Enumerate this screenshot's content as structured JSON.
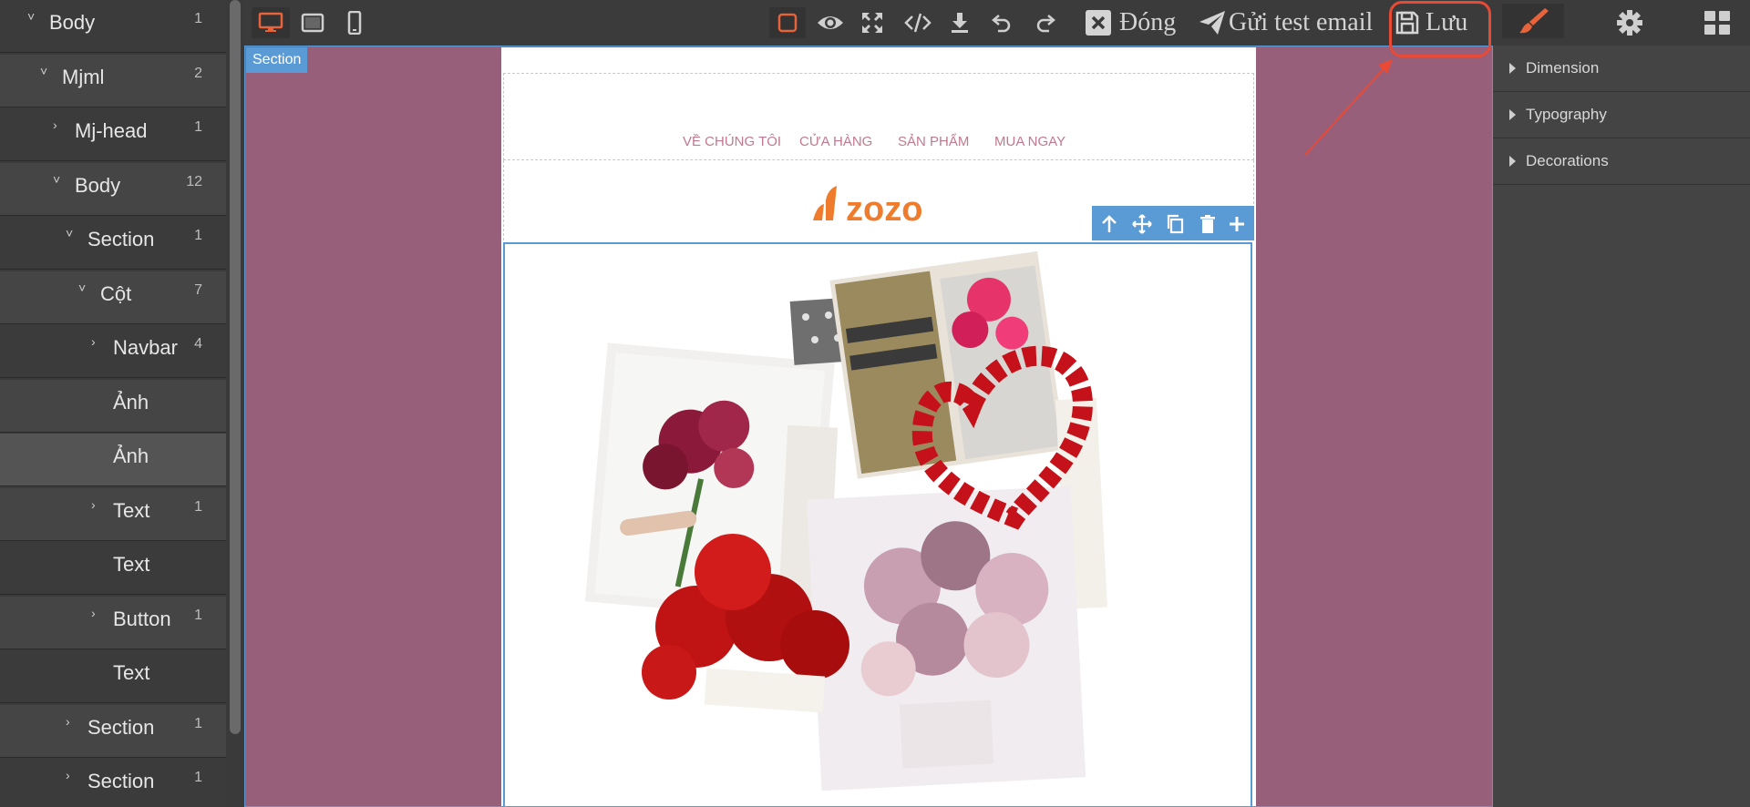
{
  "layers": [
    {
      "name": "Body",
      "count": "1",
      "indent": 0,
      "caret": true
    },
    {
      "name": "Mjml",
      "count": "2",
      "indent": 1,
      "caret": true
    },
    {
      "name": "Mj-head",
      "count": "1",
      "indent": 2,
      "caret": true,
      "collapsed": true
    },
    {
      "name": "Body",
      "count": "12",
      "indent": 2,
      "caret": true
    },
    {
      "name": "Section",
      "count": "1",
      "indent": 3,
      "caret": true
    },
    {
      "name": "Cột",
      "count": "7",
      "indent": 4,
      "caret": true
    },
    {
      "name": "Navbar",
      "count": "4",
      "indent": 5,
      "caret": true,
      "collapsed": true
    },
    {
      "name": "Ảnh",
      "count": "",
      "indent": 5,
      "caret": false
    },
    {
      "name": "Ảnh",
      "count": "",
      "indent": 5,
      "caret": false,
      "selected": true
    },
    {
      "name": "Text",
      "count": "1",
      "indent": 5,
      "caret": true,
      "collapsed": true
    },
    {
      "name": "Text",
      "count": "",
      "indent": 5,
      "caret": false
    },
    {
      "name": "Button",
      "count": "1",
      "indent": 5,
      "caret": true,
      "collapsed": true
    },
    {
      "name": "Text",
      "count": "",
      "indent": 5,
      "caret": false
    },
    {
      "name": "Section",
      "count": "1",
      "indent": 3,
      "caret": true,
      "collapsed": true
    },
    {
      "name": "Section",
      "count": "1",
      "indent": 3,
      "caret": true,
      "collapsed": true
    }
  ],
  "toolbar": {
    "close_label": "Đóng",
    "send_test_label": "Gửi test email",
    "save_label": "Lưu"
  },
  "canvas": {
    "section_badge": "Section",
    "nav_links": [
      "VỀ CHÚNG TÔI",
      "CỬA HÀNG",
      "SẢN PHẨM",
      "MUA NGAY"
    ],
    "logo_text": "zozo"
  },
  "style_sectors": [
    "Dimension",
    "Typography",
    "Decorations"
  ],
  "colors": {
    "accent": "#e8633a",
    "canvas_bg": "#975f7a",
    "selection": "#5b9bd5",
    "highlight": "#e94a35",
    "logo": "#ef7b2d"
  }
}
